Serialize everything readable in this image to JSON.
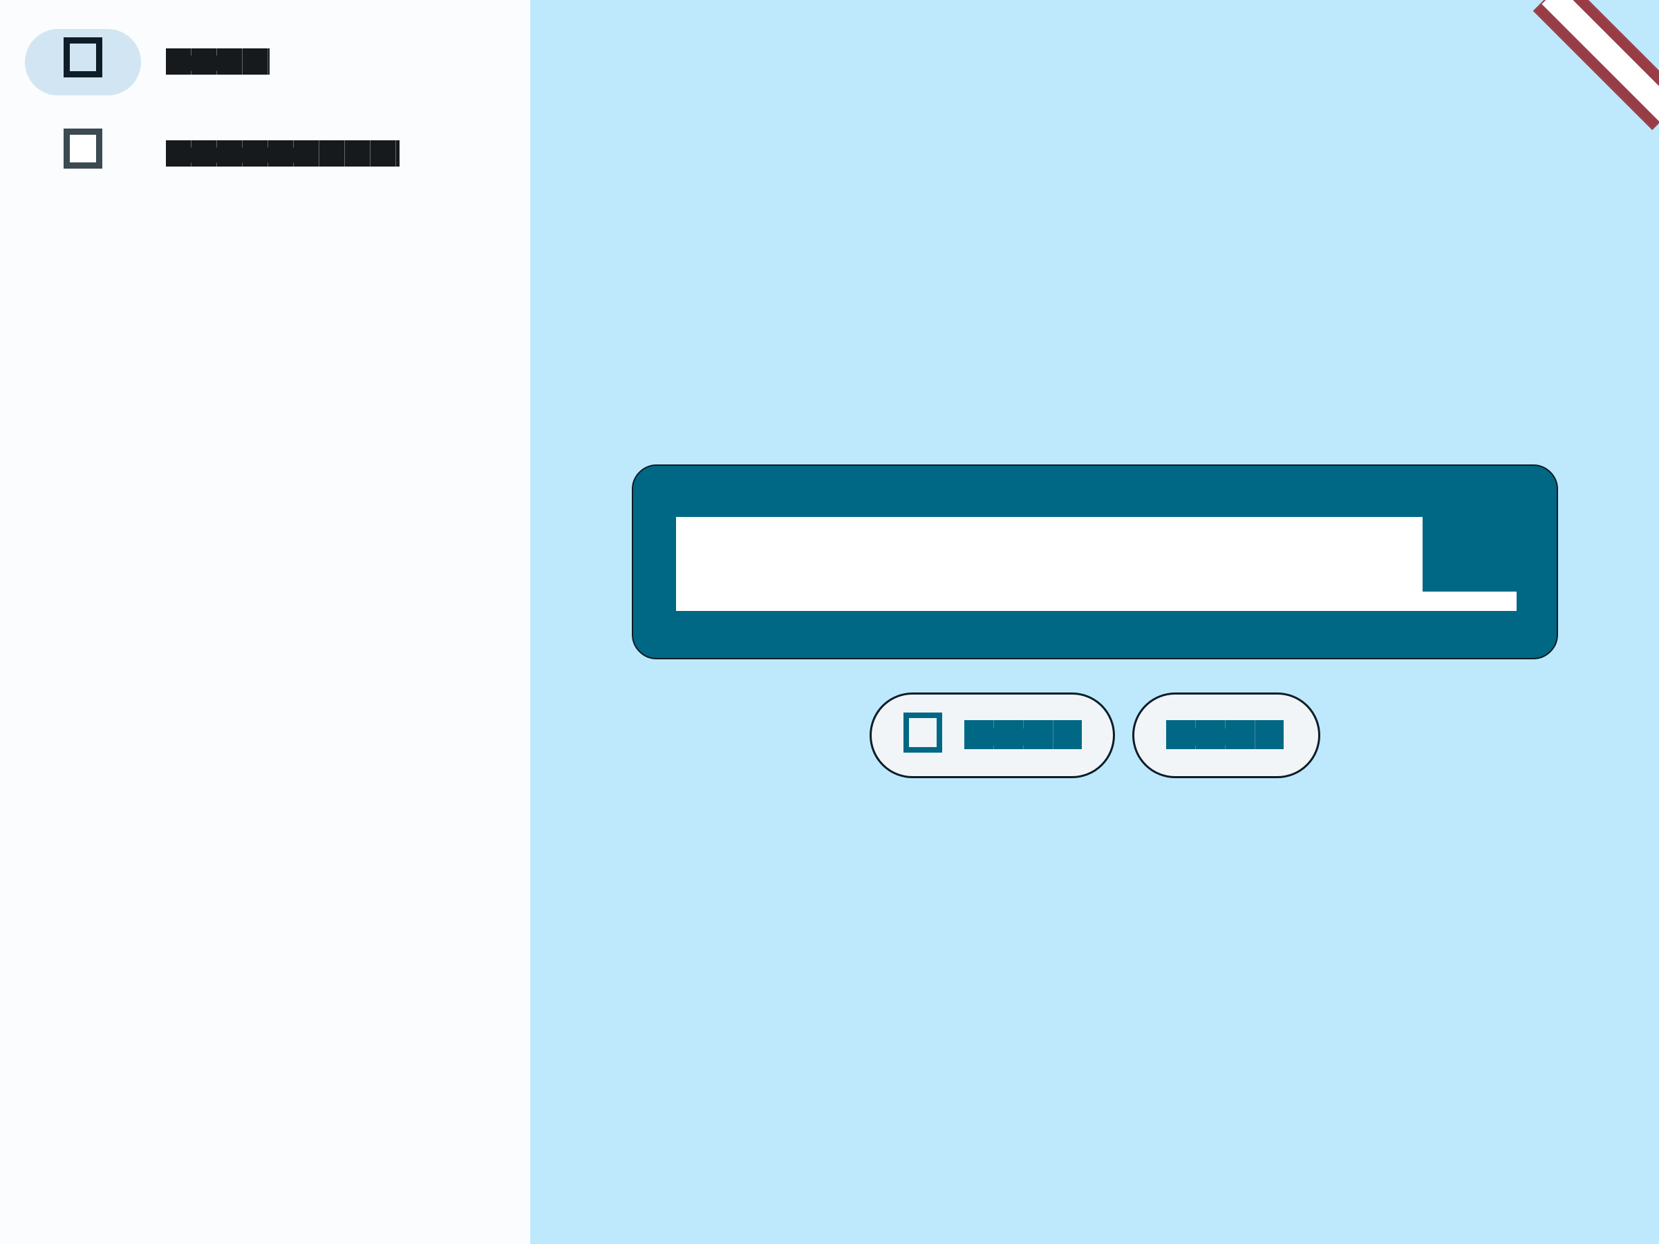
{
  "sidebar": {
    "items": [
      {
        "label": "■■■■",
        "icon": "square-icon",
        "active": true
      },
      {
        "label": "■■■■■■■■■",
        "icon": "square-icon",
        "active": false
      }
    ]
  },
  "main": {
    "input": {
      "value": "",
      "placeholder": ""
    },
    "buttons": [
      {
        "label": "■■■■",
        "icon": "square-icon"
      },
      {
        "label": "■■■■"
      }
    ]
  },
  "corner_ribbon": {
    "icon": "ribbon-icon"
  },
  "colors": {
    "background": "#bee9fc",
    "sidebar": "#fbfcfd",
    "primary": "#006885",
    "active_pill": "#d1e6f2",
    "ribbon": "#983c46",
    "text": "#171a1d"
  }
}
